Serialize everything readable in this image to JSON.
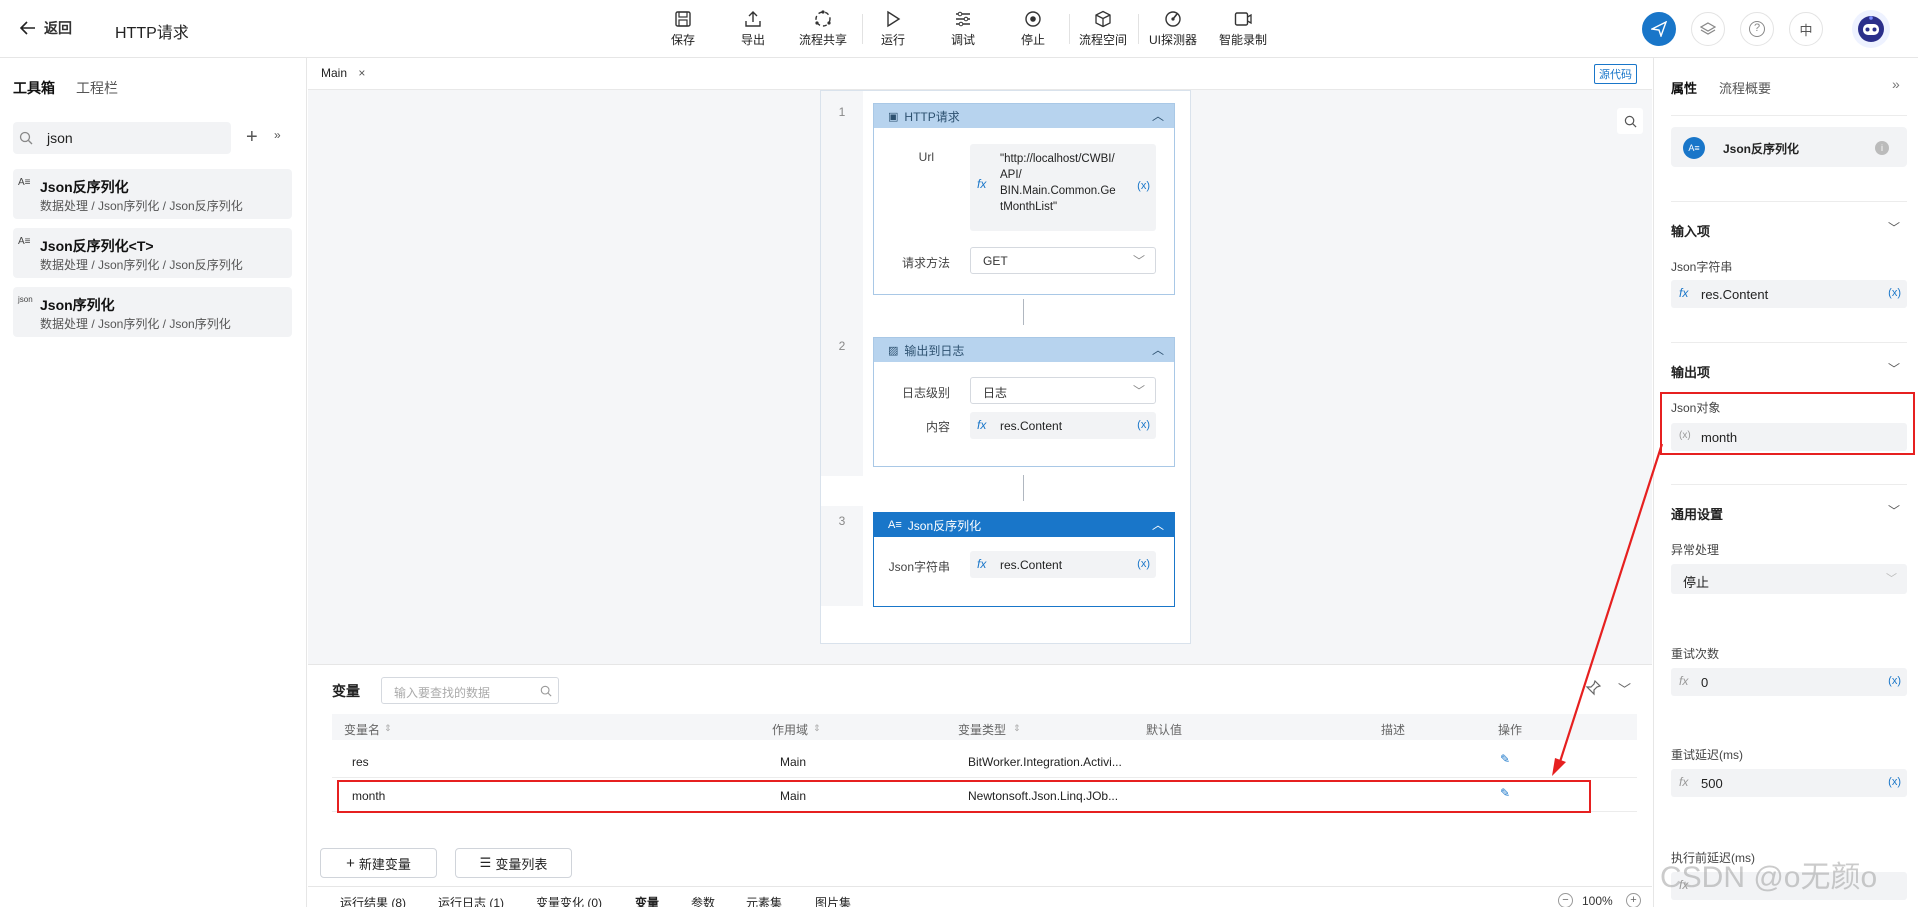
{
  "header": {
    "back_label": "返回",
    "page_title": "HTTP请求",
    "toolbar": [
      {
        "label": "保存",
        "icon": "save-icon"
      },
      {
        "label": "导出",
        "icon": "export-icon"
      },
      {
        "label": "流程共享",
        "icon": "share-icon"
      },
      {
        "label": "运行",
        "icon": "run-icon"
      },
      {
        "label": "调试",
        "icon": "debug-icon"
      },
      {
        "label": "停止",
        "icon": "stop-icon"
      },
      {
        "label": "流程空间",
        "icon": "cube-icon"
      },
      {
        "label": "UI探测器",
        "icon": "detector-icon"
      },
      {
        "label": "智能录制",
        "icon": "record-icon"
      }
    ],
    "lang_label": "中",
    "accent_color": "#1976c9"
  },
  "left_panel": {
    "tabs": [
      "工具箱",
      "工程栏"
    ],
    "search_value": "json",
    "items": [
      {
        "title": "Json反序列化",
        "path": "数据处理 / Json序列化 / Json反序列化",
        "icon_text": "A≡"
      },
      {
        "title": "Json反序列化<T>",
        "path": "数据处理 / Json序列化 / Json反序列化",
        "icon_text": "A≡"
      },
      {
        "title": "Json序列化",
        "path": "数据处理 / Json序列化 / Json序列化",
        "icon_text": "json"
      }
    ]
  },
  "canvas": {
    "tab_label": "Main",
    "source_code_label": "源代码",
    "blocks": [
      {
        "index": "1",
        "title": "HTTP请求",
        "url_label": "Url",
        "url_value": "\"http://localhost/CWBI/API/BIN.Main.Common.GetMonthList\"",
        "url_lines": [
          "\"http://localhost/CWBI/",
          "API/",
          "BIN.Main.Common.Ge",
          "tMonthList\""
        ],
        "method_label": "请求方法",
        "method_value": "GET"
      },
      {
        "index": "2",
        "title": "输出到日志",
        "level_label": "日志级别",
        "level_value": "日志",
        "content_label": "内容",
        "content_value": "res.Content"
      },
      {
        "index": "3",
        "title": "Json反序列化",
        "json_label": "Json字符串",
        "json_value": "res.Content"
      }
    ],
    "fx_symbol": "fx",
    "x_symbol": "(x)"
  },
  "variables": {
    "title": "变量",
    "search_placeholder": "输入要查找的数据",
    "columns": [
      "变量名",
      "作用域",
      "变量类型",
      "默认值",
      "描述",
      "操作"
    ],
    "rows": [
      {
        "name": "res",
        "scope": "Main",
        "type": "BitWorker.Integration.Activi..."
      },
      {
        "name": "month",
        "scope": "Main",
        "type": "Newtonsoft.Json.Linq.JOb..."
      }
    ],
    "new_var_label": "新建变量",
    "var_list_label": "变量列表"
  },
  "bottom_tabs": [
    "运行结果 (8)",
    "运行日志 (1)",
    "变量变化 (0)",
    "变量",
    "参数",
    "元素集",
    "图片集"
  ],
  "zoom": "100%",
  "right_panel": {
    "tabs": [
      "属性",
      "流程概要"
    ],
    "activity_name": "Json反序列化",
    "input_section": "输入项",
    "input_label": "Json字符串",
    "input_value": "res.Content",
    "output_section": "输出项",
    "output_label": "Json对象",
    "output_value": "month",
    "general_section": "通用设置",
    "error_label": "异常处理",
    "error_value": "停止",
    "retry_label": "重试次数",
    "retry_value": "0",
    "retry_delay_label": "重试延迟(ms)",
    "retry_delay_value": "500",
    "pre_delay_label": "执行前延迟(ms)"
  },
  "watermark": "CSDN @o无颜o",
  "highlight_color": "#e62020"
}
